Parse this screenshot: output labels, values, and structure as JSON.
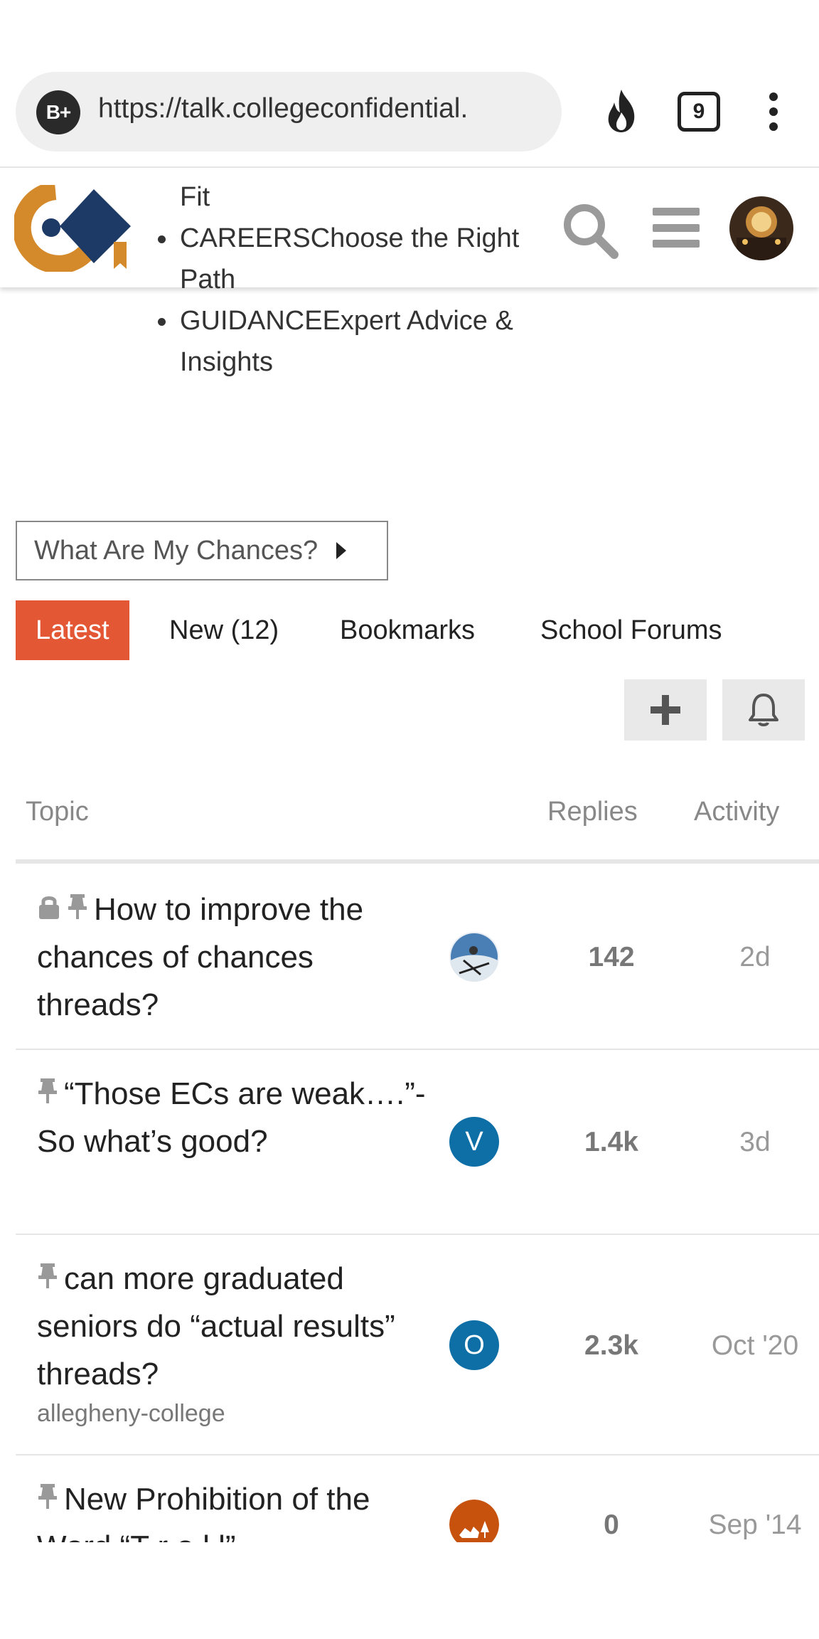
{
  "browser": {
    "url": "https://talk.collegeconfidential.",
    "site_badge": "B+",
    "tab_count": "9"
  },
  "nav": {
    "fit_fragment": "Fit",
    "items": [
      {
        "label": "CAREERSChoose the Right Path"
      },
      {
        "label": "GUIDANCEExpert Advice & Insights"
      }
    ]
  },
  "chances_dropdown": {
    "label": "What Are My Chances?"
  },
  "tabs": [
    {
      "label": "Latest",
      "active": true
    },
    {
      "label": "New (12)"
    },
    {
      "label": "Bookmarks"
    },
    {
      "label": "School Forums"
    }
  ],
  "table": {
    "headers": {
      "topic": "Topic",
      "replies": "Replies",
      "activity": "Activity"
    },
    "rows": [
      {
        "title": "How to improve the chances of chances threads?",
        "locked": true,
        "pinned": true,
        "category": "",
        "poster_initial": "",
        "poster_color": "#4a7fb5",
        "replies": "142",
        "activity": "2d"
      },
      {
        "title": "“Those ECs are weak….”- So what’s good?",
        "locked": false,
        "pinned": true,
        "category": "",
        "poster_initial": "V",
        "poster_color": "#0e6fa6",
        "replies": "1.4k",
        "activity": "3d"
      },
      {
        "title": "can more graduated seniors do “actual results” threads?",
        "locked": false,
        "pinned": true,
        "category": "allegheny-college",
        "poster_initial": "O",
        "poster_color": "#0e6fa6",
        "replies": "2.3k",
        "activity": "Oct '20"
      },
      {
        "title": "New Prohibition of the Word “T r o l l”",
        "locked": false,
        "pinned": true,
        "category": "",
        "poster_initial": "",
        "poster_color": "#c6520e",
        "replies": "0",
        "activity": "Sep '14"
      }
    ]
  },
  "colors": {
    "accent": "#e45735",
    "logo_orange": "#d4892a",
    "logo_navy": "#1d3a66"
  }
}
